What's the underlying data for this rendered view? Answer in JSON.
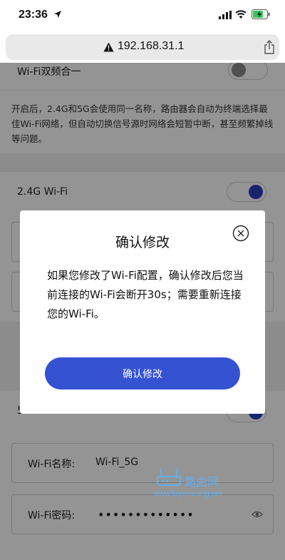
{
  "status_bar": {
    "time": "23:36",
    "icons": [
      "location-arrow-icon",
      "signal-icon",
      "wifi-icon",
      "battery-charging-icon"
    ]
  },
  "browser": {
    "url": "192.168.31.1",
    "icons": [
      "warning-icon",
      "share-icon"
    ]
  },
  "settings": {
    "dual_band_label": "Wi-Fi双频合一",
    "dual_band_enabled": false,
    "dual_band_description": "开启后，2.4G和5G会使用同一名称，路由器会自动为终端选择最佳Wi-Fi网络，但自动切换信号源时网络会短暂中断，甚至频繁掉线等问题。",
    "wifi24_label": "2.4G Wi-Fi",
    "wifi24_enabled": true,
    "wifi5_label": "5G Wi-Fi",
    "wifi5_enabled": true,
    "wifi5_name_label": "Wi-Fi名称:",
    "wifi5_name_value": "Wi-Fi_5G",
    "wifi5_password_label": "Wi-Fi密码:",
    "wifi5_password_value": "•••••••••••••"
  },
  "dialog": {
    "title": "确认修改",
    "message": "如果您修改了Wi-Fi配置，确认修改后您当前连接的Wi-Fi会断开30s；需要重新连接您的Wi-Fi。",
    "confirm_label": "确认修改"
  },
  "watermark": {
    "text": "路由网",
    "url": "www.luyouwang.net"
  },
  "colors": {
    "accent": "#3552d3",
    "toggle_on": "#2b3fbf",
    "toggle_off": "#8a8a8a",
    "overlay": "rgba(0,0,0,0.42)"
  }
}
